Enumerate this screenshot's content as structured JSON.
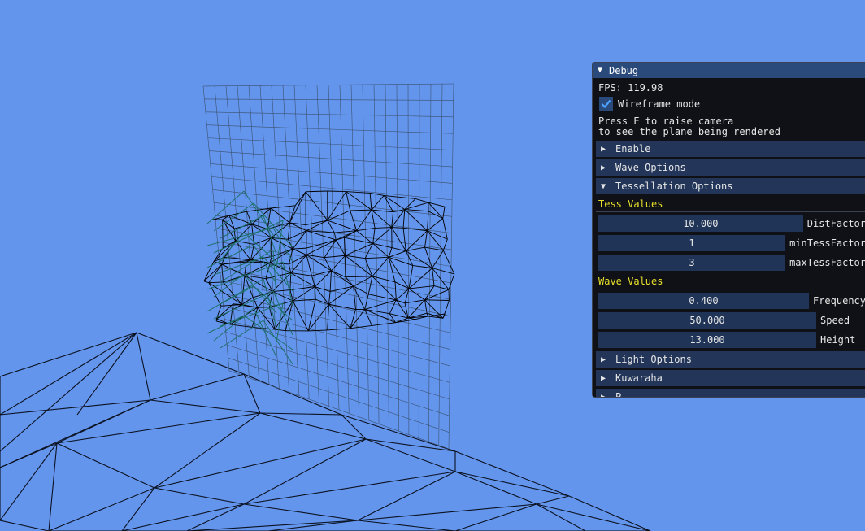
{
  "debug_window": {
    "title": "Debug",
    "fps_text": "FPS: 119.98",
    "wireframe": {
      "label": "Wireframe mode",
      "checked": true
    },
    "hint_lines": [
      "Press E to raise camera",
      "to see the plane being rendered"
    ],
    "headers": {
      "enable": "Enable",
      "wave_options": "Wave Options",
      "tessellation_options": "Tessellation Options",
      "light_options": "Light Options",
      "kuwahara": "Kuwaraha",
      "partial": "P..."
    },
    "tess_values": {
      "title": "Tess Values",
      "rows": [
        {
          "value": "10.000",
          "label": "DistFactor"
        },
        {
          "value": "1",
          "label": "minTessFactor"
        },
        {
          "value": "3",
          "label": "maxTessFactor"
        }
      ]
    },
    "wave_values": {
      "title": "Wave Values",
      "rows": [
        {
          "value": "0.400",
          "label": "Frequency"
        },
        {
          "value": "50.000",
          "label": "Speed"
        },
        {
          "value": "13.000",
          "label": "Height"
        }
      ]
    }
  },
  "colors": {
    "background": "#6495ED",
    "panel_bg": "#0f1116",
    "title_bar": "#294a7a",
    "header_bg": "#23365a",
    "slider_bg": "#1f3456",
    "section_label": "#e8e02a",
    "wire_grid": "#3a5170",
    "wire_mesh": "#000000",
    "wire_teal": "#1f6f6a"
  }
}
